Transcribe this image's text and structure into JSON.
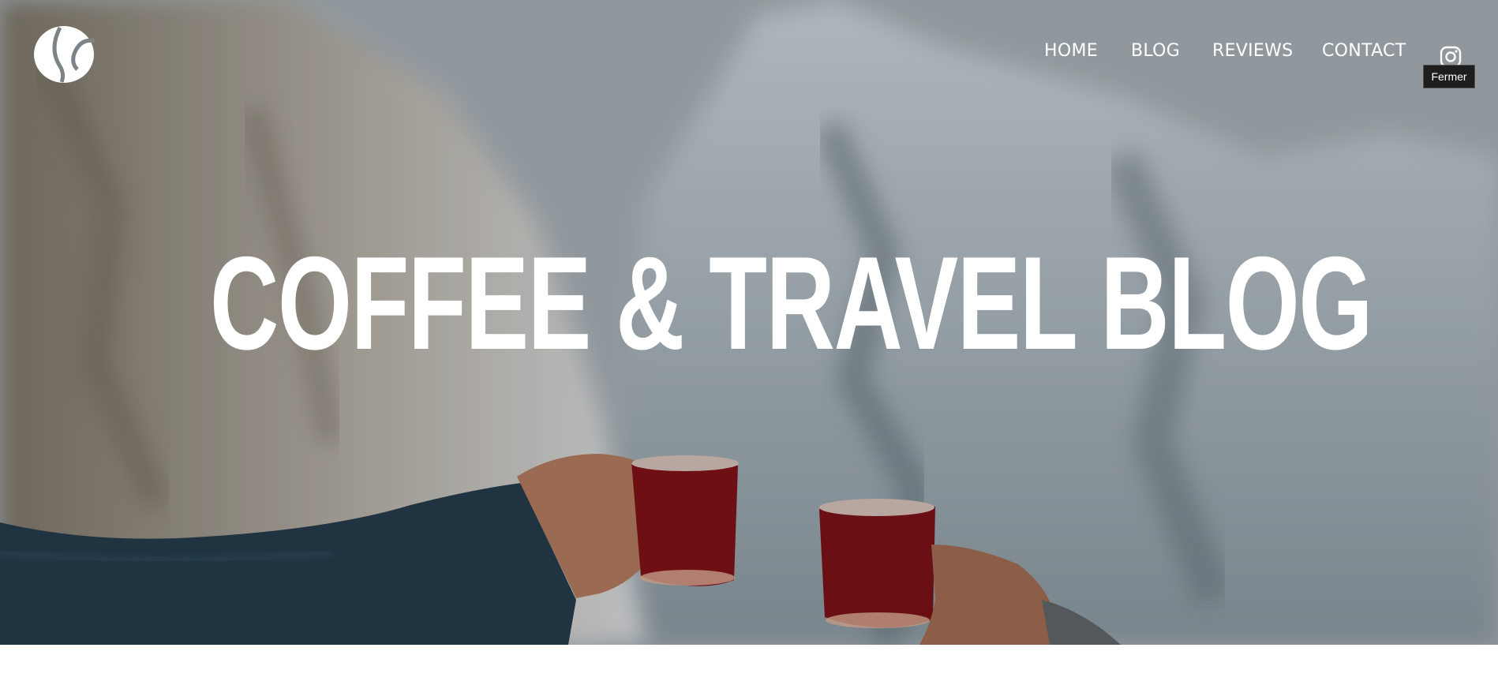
{
  "header": {
    "logo_icon": "coffee-bean-icon",
    "nav": [
      {
        "label": "HOME"
      },
      {
        "label": "BLOG"
      },
      {
        "label": "REVIEWS"
      },
      {
        "label": "CONTACT"
      }
    ],
    "social_icon": "instagram-icon",
    "tooltip": "Fermer"
  },
  "hero": {
    "title": "COFFEE & TRAVEL BLOG",
    "background": "mountain-photo-with-two-red-mugs"
  },
  "colors": {
    "text": "#ffffff",
    "mug": "#6e0f14",
    "sleeve": "#1f3340"
  }
}
